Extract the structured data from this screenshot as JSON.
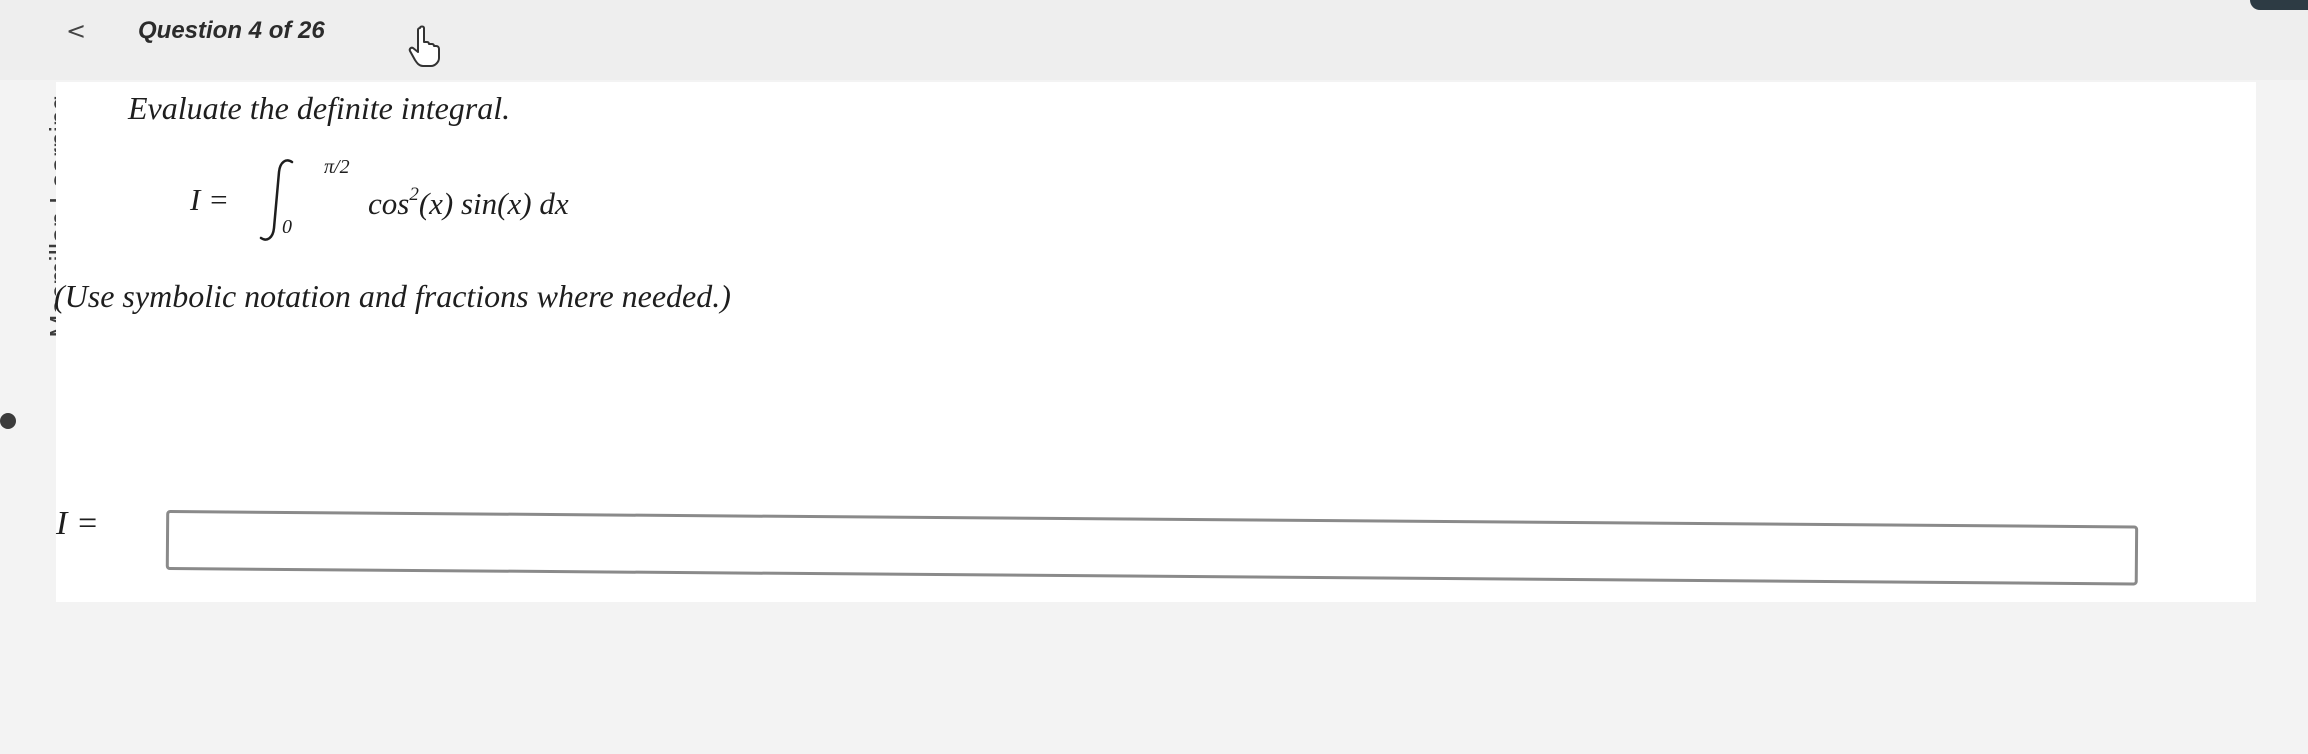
{
  "header": {
    "back_icon": "chevron-left-icon",
    "back_glyph": "<",
    "question_counter": "Question 4 of 26",
    "cursor_icon": "hand-pointer-icon"
  },
  "brand": {
    "name": "Macmillan Learning",
    "copyright_icon": "copyright-icon"
  },
  "question": {
    "prompt": "Evaluate the definite integral.",
    "formula": {
      "lhs": "I =",
      "upper_limit": "π/2",
      "lower_limit": "0",
      "integrand_pre": "cos",
      "exponent": "2",
      "integrand_post": "(x) sin(x) dx"
    },
    "instruction": "(Use symbolic notation and fractions where needed.)"
  },
  "answer": {
    "label": "I =",
    "value": "",
    "placeholder": ""
  },
  "colors": {
    "background": "#f3f3f3",
    "panel": "#ffffff",
    "input_border": "#8a8a8a",
    "text": "#1e1e1e",
    "corner_button": "#2d3b44"
  }
}
